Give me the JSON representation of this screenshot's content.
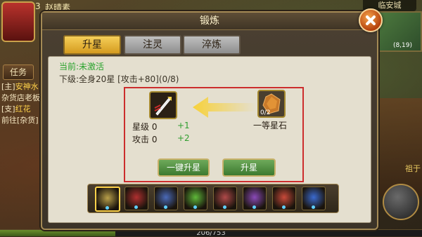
{
  "player": {
    "level": "3",
    "name": "赵晴素"
  },
  "location": {
    "city": "临安城",
    "coords": "(8,19)"
  },
  "left_panel": {
    "task_button": "任务",
    "tasks": [
      {
        "tag": "[主]",
        "npc": "安神水"
      },
      {
        "tag": "",
        "npc": "",
        "text": "杂货店老板"
      },
      {
        "tag": "[支]",
        "npc": "红花"
      },
      {
        "tag": "",
        "npc": "",
        "text": "前往[杂货]"
      }
    ]
  },
  "right_panel": {
    "text": "祖于"
  },
  "experience": {
    "current": 206,
    "max": 753,
    "label": "206/753"
  },
  "dialog": {
    "title": "锻炼",
    "tabs": [
      {
        "label": "升星",
        "active": true
      },
      {
        "label": "注灵",
        "active": false
      },
      {
        "label": "淬炼",
        "active": false
      }
    ],
    "status": "当前:未激活",
    "next_level": "下级:全身20星 [攻击+80](0/8)",
    "material": {
      "name": "一等星石",
      "count": "0/2"
    },
    "stats": [
      {
        "label": "星级 0",
        "bonus": "+1"
      },
      {
        "label": "攻击 0",
        "bonus": "+2"
      }
    ],
    "buttons": {
      "auto": "一键升星",
      "upgrade": "升星"
    }
  },
  "equipment": [
    {
      "name": "weapon",
      "selected": true,
      "color": "#b9a04a"
    },
    {
      "name": "armor",
      "selected": false,
      "color": "#b03030"
    },
    {
      "name": "helmet",
      "selected": false,
      "color": "#4a6ab9"
    },
    {
      "name": "boots",
      "selected": false,
      "color": "#5fb93a"
    },
    {
      "name": "belt",
      "selected": false,
      "color": "#b04a4a"
    },
    {
      "name": "ring",
      "selected": false,
      "color": "#8a4ab9"
    },
    {
      "name": "necklace",
      "selected": false,
      "color": "#c94a3a"
    },
    {
      "name": "amulet",
      "selected": false,
      "color": "#3a6ad0"
    }
  ],
  "colors": {
    "accent": "#d49b1f",
    "highlight_box": "#cc2d2d",
    "positive": "#2f9e2f"
  }
}
